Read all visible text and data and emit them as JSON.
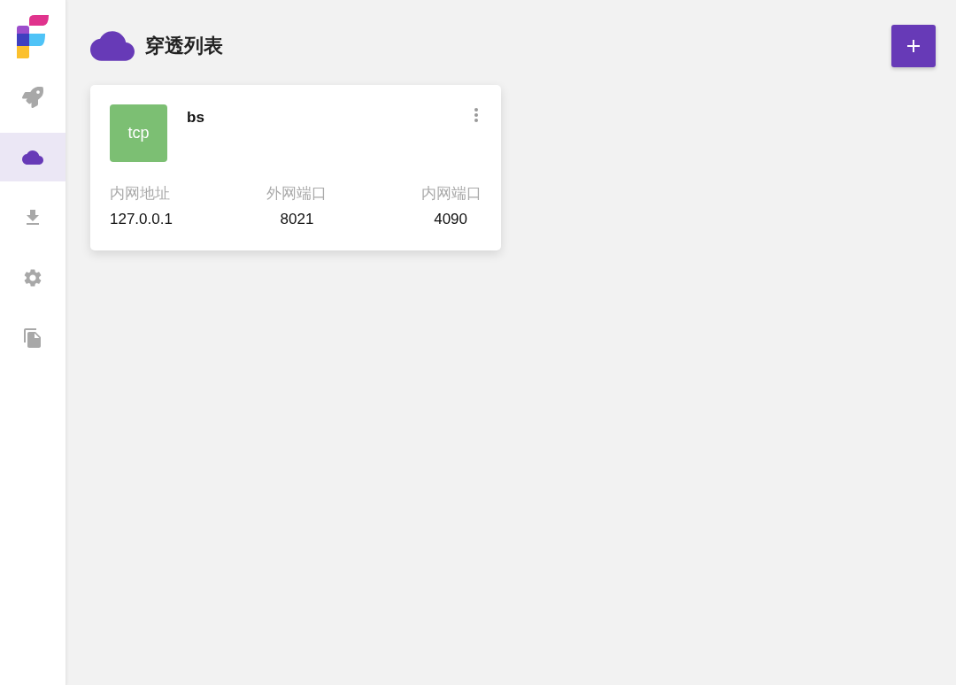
{
  "sidebar": {
    "items": [
      {
        "kind": "rocket",
        "selected": false
      },
      {
        "kind": "cloud",
        "selected": true
      },
      {
        "kind": "download",
        "selected": false
      },
      {
        "kind": "settings",
        "selected": false
      },
      {
        "kind": "documents",
        "selected": false
      }
    ]
  },
  "header": {
    "title": "穿透列表"
  },
  "tunnels": [
    {
      "protocol": "tcp",
      "name": "bs",
      "fields": [
        {
          "label": "内网地址",
          "value": "127.0.0.1"
        },
        {
          "label": "外网端口",
          "value": "8021"
        },
        {
          "label": "内网端口",
          "value": "4090"
        }
      ]
    }
  ]
}
